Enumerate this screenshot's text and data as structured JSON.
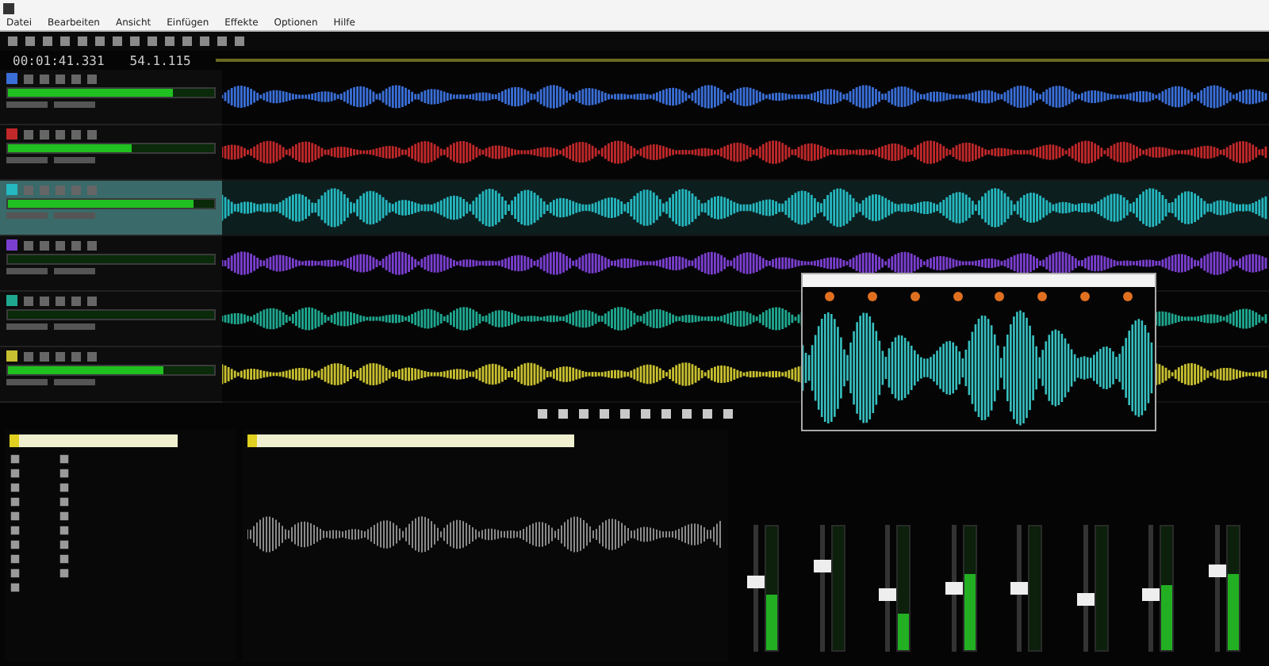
{
  "menu": [
    "Datei",
    "Bearbeiten",
    "Ansicht",
    "Einfügen",
    "Effekte",
    "Optionen",
    "Hilfe"
  ],
  "timecode": {
    "position": "00:01:41.331",
    "bars": "54.1.115"
  },
  "tracks": [
    {
      "color": "#3a6fd8",
      "selected": false,
      "level": 0.8
    },
    {
      "color": "#c0282a",
      "selected": false,
      "level": 0.6
    },
    {
      "color": "#25b8c0",
      "selected": true,
      "level": 0.9
    },
    {
      "color": "#7a3fd0",
      "selected": false,
      "level": 0.0
    },
    {
      "color": "#1fa890",
      "selected": false,
      "level": 0.0
    },
    {
      "color": "#c8c030",
      "selected": false,
      "level": 0.75
    }
  ],
  "mixer": [
    {
      "meter": {
        "level": 0.45
      },
      "fader": {
        "level": 0.55
      }
    },
    {
      "meter": {
        "level": 0.0
      },
      "fader": {
        "level": 0.7
      }
    },
    {
      "meter": {
        "level": 0.3
      },
      "fader": {
        "level": 0.45
      }
    },
    {
      "meter": {
        "level": 0.62
      },
      "fader": {
        "level": 0.5
      }
    },
    {
      "meter": {
        "level": 0.0
      },
      "fader": {
        "level": 0.5
      }
    },
    {
      "meter": {
        "level": 0.0
      },
      "fader": {
        "level": 0.4
      }
    },
    {
      "meter": {
        "level": 0.52
      },
      "fader": {
        "level": 0.45
      }
    },
    {
      "meter": {
        "level": 0.62
      },
      "fader": {
        "level": 0.65
      }
    }
  ]
}
